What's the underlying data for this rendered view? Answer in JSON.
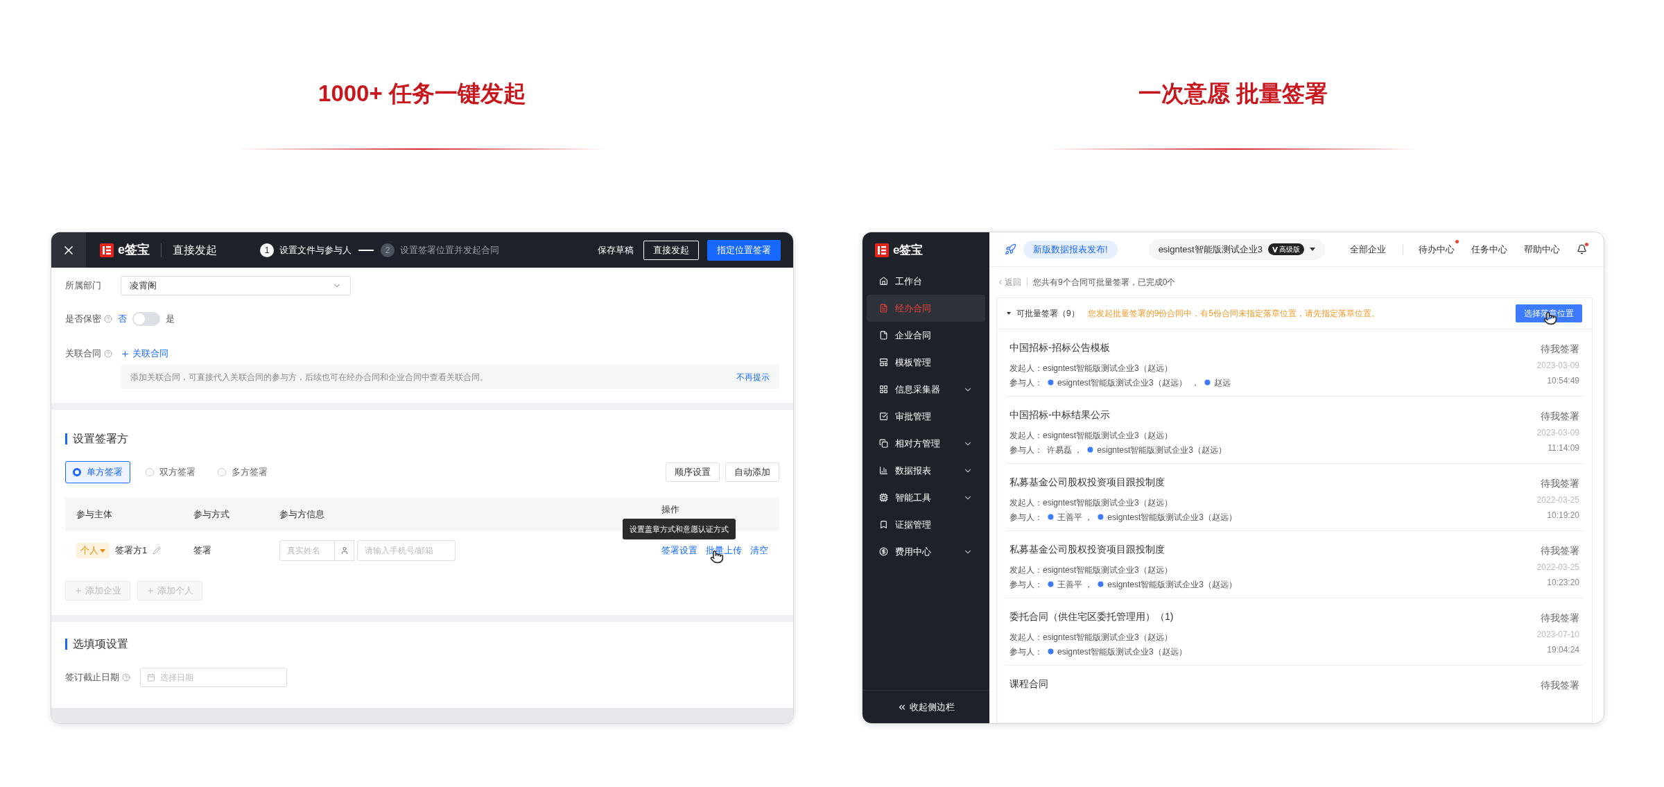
{
  "left_panel": {
    "heading": "1000+ 任务一键发起",
    "app": {
      "header": {
        "logo_text": "e签宝",
        "title": "直接发起",
        "steps": [
          {
            "number": "1",
            "label": "设置文件与参与人",
            "selected": true
          },
          {
            "number": "2",
            "label": "设置签署位置并发起合同",
            "selected": false
          }
        ],
        "actions": [
          {
            "label": "保存草稿",
            "kind": "text"
          },
          {
            "label": "直接发起",
            "kind": "outline"
          },
          {
            "label": "指定位置签署",
            "kind": "primary"
          }
        ]
      },
      "department": {
        "label": "所属部门",
        "value": "凌霄阁"
      },
      "confidential": {
        "label": "是否保密",
        "off_label": "否",
        "on_label": "是",
        "on": false
      },
      "related": {
        "label": "关联合同",
        "link": "关联合同",
        "notice": "添加关联合同，可直接代入关联合同的参与方，后续也可在经办合同和企业合同中查看关联合同。",
        "dismiss": "不再提示"
      },
      "signers": {
        "title": "设置签署方",
        "modes": [
          {
            "label": "单方签署",
            "selected": true
          },
          {
            "label": "双方签署",
            "selected": false
          },
          {
            "label": "多方签署",
            "selected": false
          }
        ],
        "buttons": [
          "顺序设置",
          "自动添加"
        ],
        "columns": [
          "参与主体",
          "参与方式",
          "参与方信息",
          "操作"
        ],
        "rows": [
          {
            "type_tag": "个人",
            "name": "签署方1",
            "method": "签署",
            "name_placeholder": "真实姓名",
            "contact_placeholder": "请输入手机号/邮箱",
            "actions": [
              "签署设置",
              "批量上传",
              "清空"
            ]
          }
        ],
        "tooltip": "设置盖章方式和意愿认证方式",
        "add_buttons": [
          {
            "label": "添加企业",
            "disabled": true
          },
          {
            "label": "添加个人",
            "disabled": true
          }
        ]
      },
      "optional": {
        "title": "选填项设置",
        "deadline_label": "签订截止日期",
        "deadline_placeholder": "选择日期"
      }
    }
  },
  "right_panel": {
    "heading": "一次意愿 批量签署",
    "app": {
      "logo_text": "e签宝",
      "nav": [
        {
          "label": "工作台",
          "selected": false,
          "expandable": false
        },
        {
          "label": "经办合同",
          "selected": true,
          "expandable": false
        },
        {
          "label": "企业合同",
          "selected": false,
          "expandable": false
        },
        {
          "label": "模板管理",
          "selected": false,
          "expandable": false
        },
        {
          "label": "信息采集器",
          "selected": false,
          "expandable": true
        },
        {
          "label": "审批管理",
          "selected": false,
          "expandable": false
        },
        {
          "label": "相对方管理",
          "selected": false,
          "expandable": true
        },
        {
          "label": "数据报表",
          "selected": false,
          "expandable": true
        },
        {
          "label": "智能工具",
          "selected": false,
          "expandable": true
        },
        {
          "label": "证据管理",
          "selected": false,
          "expandable": false
        },
        {
          "label": "费用中心",
          "selected": false,
          "expandable": true
        }
      ],
      "collapse": "收起侧边栏",
      "topbar": {
        "announcement": "新版数据报表发布!",
        "company": "esigntest智能版测试企业3",
        "plan": "高级版",
        "links": [
          {
            "label": "全部企业",
            "dot": false
          },
          {
            "label": "待办中心",
            "dot": true
          },
          {
            "label": "任务中心",
            "dot": false
          },
          {
            "label": "帮助中心",
            "dot": false
          }
        ],
        "bell_dot": true
      },
      "back": "返回",
      "summary": "您共有9个合同可批量签署，已完成0个",
      "group": {
        "title": "可批量签署（9）",
        "expanded": true,
        "warning": "您发起批量签署的9份合同中，有5份合同未指定落章位置，请先指定落章位置。",
        "button": "选择落章位置"
      },
      "contracts": [
        {
          "title": "中国招标-招标公告模板",
          "status": "待我签署",
          "date": "2023-03-09",
          "time": "10:54:49",
          "initiator_label": "发起人：",
          "initiator": "esigntest智能版测试企业3（赵远）",
          "participants_label": "参与人：",
          "participants": [
            {
              "name": "esigntest智能版测试企业3（赵远）  ，",
              "icon": true
            },
            {
              "name": "赵远",
              "icon": true
            }
          ]
        },
        {
          "title": "中国招标-中标结果公示",
          "status": "待我签署",
          "date": "2023-03-09",
          "time": "11:14:09",
          "initiator_label": "发起人：",
          "initiator": "esigntest智能版测试企业3（赵远）",
          "participants_label": "参与人：",
          "participants": [
            {
              "name": "许易磊 ，",
              "icon": false
            },
            {
              "name": "esigntest智能版测试企业3（赵远）",
              "icon": true
            }
          ]
        },
        {
          "title": "私募基金公司股权投资项目跟投制度",
          "status": "待我签署",
          "date": "2022-03-25",
          "time": "10:19:20",
          "initiator_label": "发起人：",
          "initiator": "esigntest智能版测试企业3（赵远）",
          "participants_label": "参与人：",
          "participants": [
            {
              "name": "王善平 ，",
              "icon": true
            },
            {
              "name": "esigntest智能版测试企业3（赵远）",
              "icon": true
            }
          ]
        },
        {
          "title": "私募基金公司股权投资项目跟投制度",
          "status": "待我签署",
          "date": "2022-03-25",
          "time": "10:23:20",
          "initiator_label": "发起人：",
          "initiator": "esigntest智能版测试企业3（赵远）",
          "participants_label": "参与人：",
          "participants": [
            {
              "name": "王善平 ，",
              "icon": true
            },
            {
              "name": "esigntest智能版测试企业3（赵远）",
              "icon": true
            }
          ]
        },
        {
          "title": "委托合同（供住宅区委托管理用）（1)",
          "status": "待我签署",
          "date": "2023-07-10",
          "time": "19:04:24",
          "initiator_label": "发起人：",
          "initiator": "esigntest智能版测试企业3（赵远）",
          "participants_label": "参与人：",
          "participants": [
            {
              "name": "esigntest智能版测试企业3（赵远）",
              "icon": true
            }
          ]
        },
        {
          "title": "课程合同",
          "status": "待我签署"
        }
      ]
    }
  }
}
